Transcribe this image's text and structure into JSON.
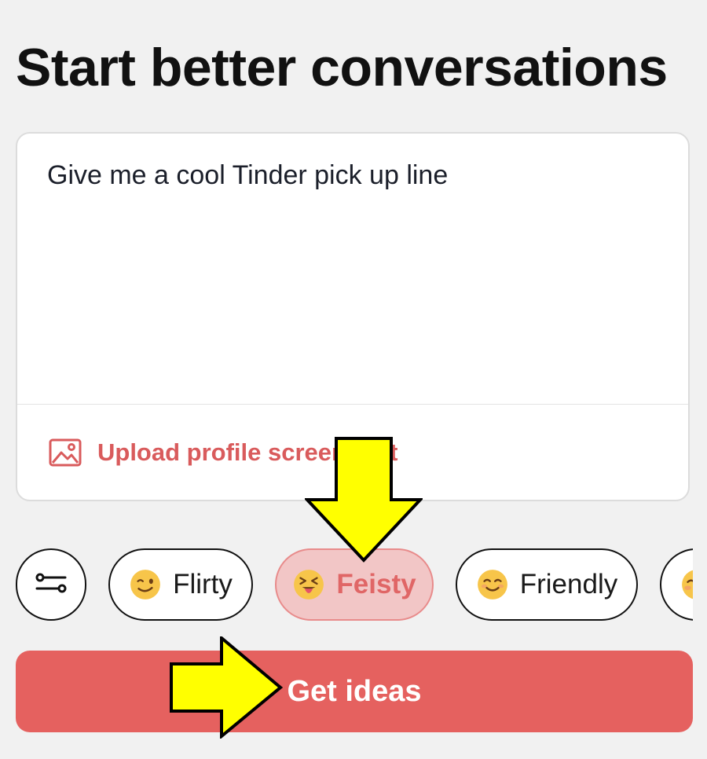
{
  "page": {
    "title": "Start better conversations"
  },
  "prompt": {
    "value": "Give me a cool Tinder pick up line",
    "placeholder": ""
  },
  "upload": {
    "label": "Upload profile screenshot",
    "icon": "image-icon"
  },
  "tones": {
    "settings_icon": "sliders-icon",
    "items": [
      {
        "emoji": "winking-face",
        "label": "Flirty",
        "selected": false
      },
      {
        "emoji": "squinting-face-with-tongue",
        "label": "Feisty",
        "selected": true
      },
      {
        "emoji": "smiling-face",
        "label": "Friendly",
        "selected": false
      }
    ]
  },
  "cta": {
    "label": "Get ideas"
  },
  "annotations": {
    "arrow_color": "#ffff00",
    "arrows": [
      "down-arrow",
      "right-arrow"
    ]
  },
  "colors": {
    "accent": "#e5615f",
    "accent_text": "#d95b5c",
    "selected_chip_bg": "#f2c6c6",
    "background": "#f1f1f1"
  }
}
